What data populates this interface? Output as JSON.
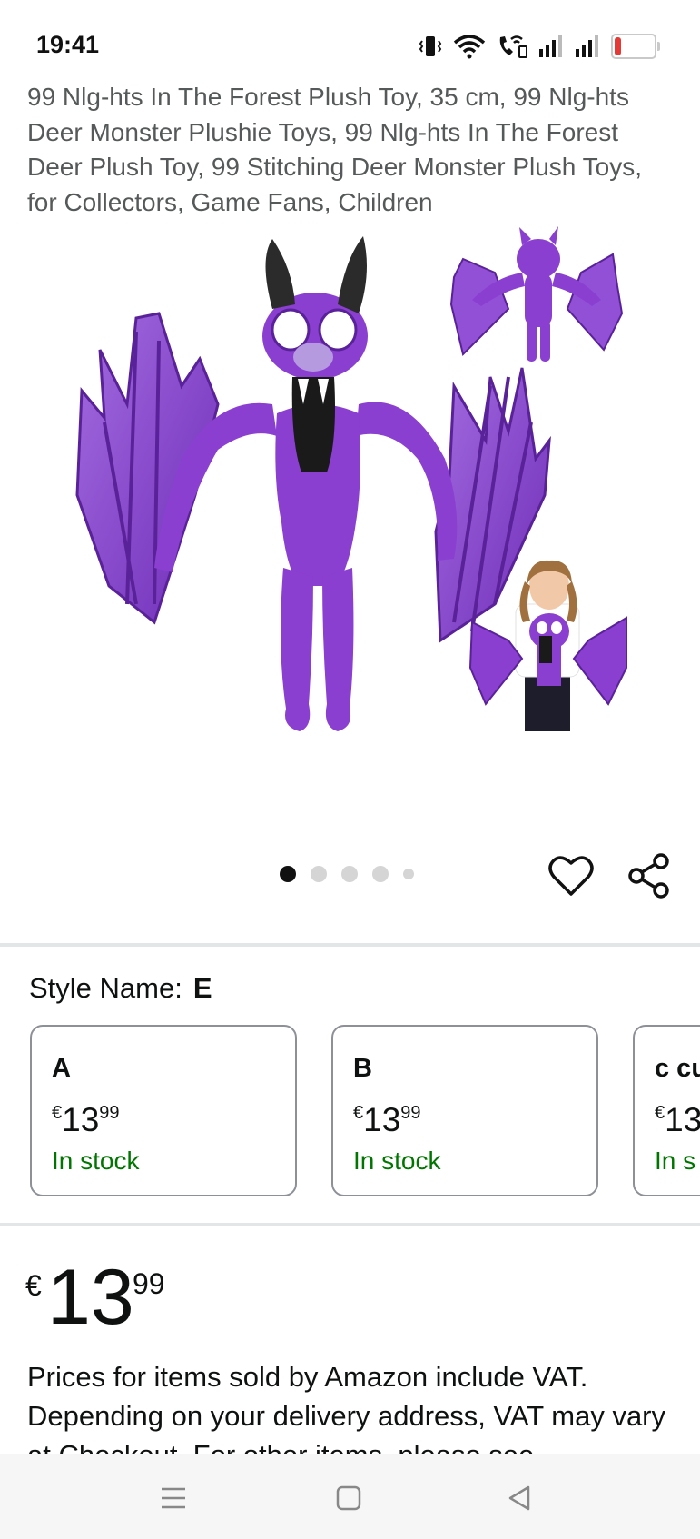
{
  "status_bar": {
    "time": "19:41",
    "battery_level": "19",
    "icons": [
      "vibrate-icon",
      "wifi-icon",
      "wifi-calling-icon",
      "signal-icon",
      "signal-icon-2",
      "battery-icon"
    ]
  },
  "product": {
    "title": "99 Nlg-hts In The Forest Plush Toy, 35 cm, 99 Nlg-hts Deer Monster Plushie Toys, 99 Nlg-hts In The Forest Deer Plush Toy, 99 Stitching Deer Monster Plush Toys, for Collectors, Game Fans, Children",
    "image_description": "purple bat plush toy"
  },
  "carousel": {
    "total_dots": 5,
    "active_index": 0
  },
  "actions": {
    "wishlist_icon": "heart-icon",
    "share_icon": "share-icon"
  },
  "style": {
    "label": "Style Name:",
    "selected": "E",
    "variants": [
      {
        "name": "A",
        "currency": "€",
        "whole": "13",
        "fraction": "99",
        "stock": "In stock"
      },
      {
        "name": "B",
        "currency": "€",
        "whole": "13",
        "fraction": "99",
        "stock": "In stock"
      },
      {
        "name": "c cu",
        "currency": "€",
        "whole": "13",
        "fraction": "",
        "stock": "In s"
      }
    ]
  },
  "price": {
    "currency": "€",
    "whole": "13",
    "fraction": "99"
  },
  "vat_text": "Prices for items sold by Amazon include VAT. Depending on your delivery address, VAT may vary at Checkout. For other items, please see",
  "nav_bar": {
    "icons": [
      "menu-icon",
      "home-icon",
      "back-icon"
    ]
  },
  "colors": {
    "stock_green": "#007600",
    "plush_purple": "#8a3fd0",
    "battery_red": "#e53935"
  }
}
